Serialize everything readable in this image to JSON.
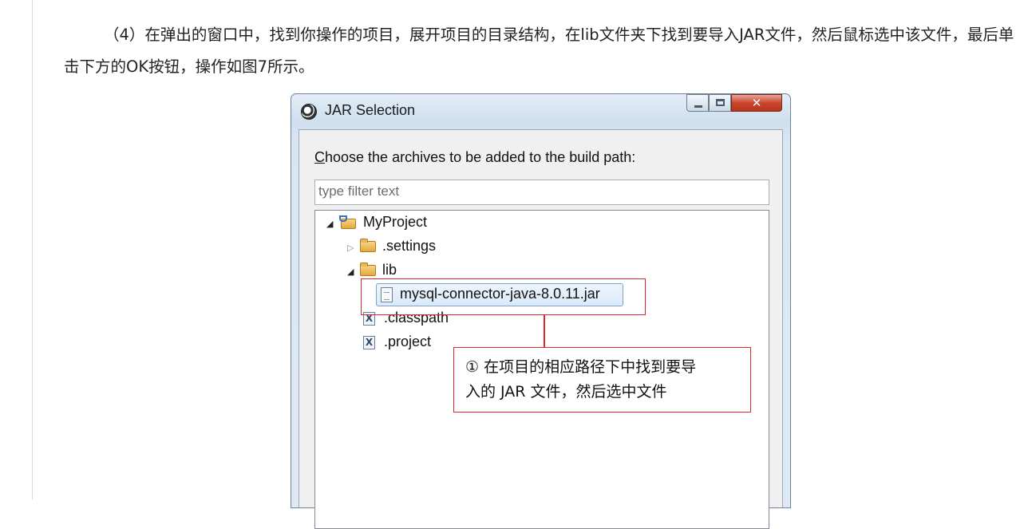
{
  "article": {
    "paragraph": "（4）在弹出的窗口中，找到你操作的项目，展开项目的目录结构，在lib文件夹下找到要导入JAR文件，然后鼠标选中该文件，最后单击下方的OK按钮，操作如图7所示。"
  },
  "dialog": {
    "title": "JAR Selection",
    "app_icon": "eclipse-icon",
    "window_buttons": {
      "minimize": "minimize-icon",
      "maximize": "maximize-icon",
      "close": "✕"
    },
    "prompt_accel": "C",
    "prompt_rest": "hoose the archives to be added to the build path:",
    "filter": {
      "placeholder": "type filter text",
      "value": ""
    },
    "tree": {
      "items": [
        {
          "label": "MyProject",
          "expanded": true,
          "icon": "project-folder-icon"
        },
        {
          "label": ".settings",
          "expanded": false,
          "icon": "folder-icon"
        },
        {
          "label": "lib",
          "expanded": true,
          "icon": "folder-icon"
        },
        {
          "label": "mysql-connector-java-8.0.11.jar",
          "selected": true,
          "icon": "jar-file-icon"
        },
        {
          "label": ".classpath",
          "icon": "xml-file-icon"
        },
        {
          "label": ".project",
          "icon": "xml-file-icon"
        }
      ]
    }
  },
  "annotation": {
    "line1": "① 在项目的相应路径下中找到要导",
    "line2": "入的 JAR 文件，然后选中文件",
    "color": "#e0262b"
  }
}
